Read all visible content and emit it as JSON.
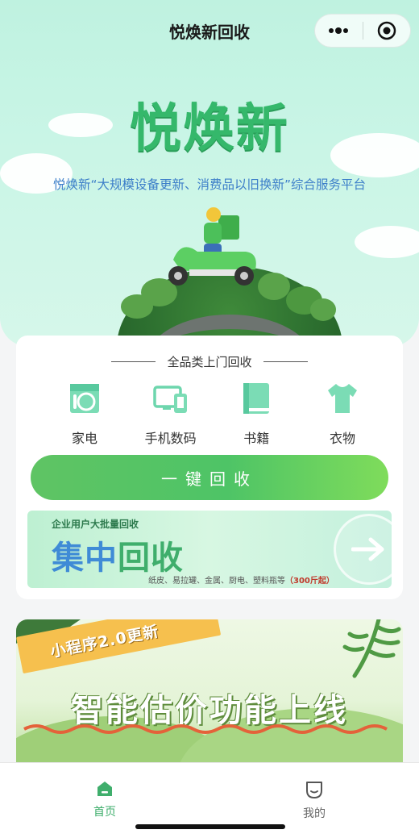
{
  "app": {
    "title": "悦焕新回收"
  },
  "hero": {
    "logo_text": "悦焕新",
    "slogan": "悦焕新“大规模设备更新、消费品以旧换新”综合服务平台"
  },
  "recycle_card": {
    "title": "全品类上门回收",
    "categories": [
      {
        "label": "家电",
        "icon": "washing-machine-icon"
      },
      {
        "label": "手机数码",
        "icon": "phone-tablet-icon"
      },
      {
        "label": "书籍",
        "icon": "book-icon"
      },
      {
        "label": "衣物",
        "icon": "tshirt-icon"
      }
    ],
    "cta_label": "一键回收",
    "enterprise": {
      "subtitle": "企业用户大批量回收",
      "title_part1": "集中",
      "title_part2": "回收",
      "note": "纸皮、易拉罐、金属、厨电、塑料瓶等",
      "note_highlight": "（300斤起）"
    }
  },
  "banner": {
    "ribbon_text": "小程序2.0更新",
    "title": "智能估价功能上线"
  },
  "tabbar": {
    "items": [
      {
        "label": "首页",
        "icon": "home-icon",
        "active": true
      },
      {
        "label": "我的",
        "icon": "profile-icon",
        "active": false
      }
    ]
  },
  "colors": {
    "brand_green": "#35b86b",
    "cta_green": "#5fc464",
    "slogan_blue": "#3d7fc9",
    "tab_active": "#3fae6c",
    "tab_inactive": "#666666"
  }
}
